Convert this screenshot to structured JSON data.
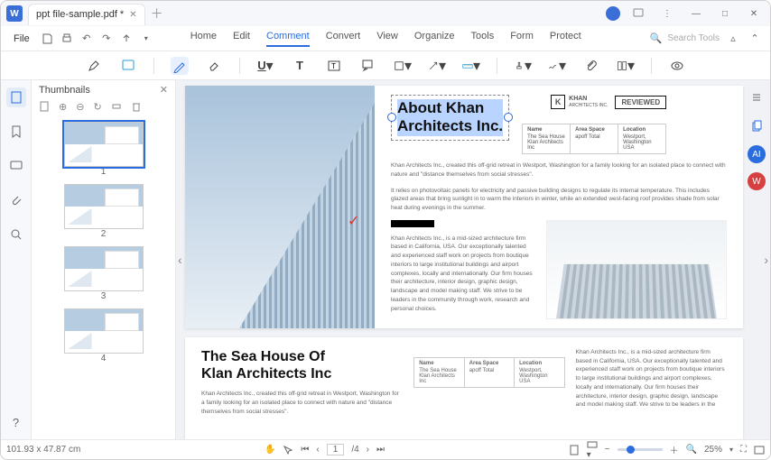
{
  "title": "ppt file-sample.pdf *",
  "fileMenu": "File",
  "menus": [
    "Home",
    "Edit",
    "Comment",
    "Convert",
    "View",
    "Organize",
    "Tools",
    "Form",
    "Protect"
  ],
  "activeMenu": "Comment",
  "searchPlaceholder": "Search Tools",
  "thumbnails": {
    "title": "Thumbnails",
    "labels": [
      "1",
      "2",
      "3",
      "4"
    ]
  },
  "page1": {
    "heading1": "About Khan",
    "heading2": "Architects Inc.",
    "logo": {
      "name": "KHAN",
      "sub": "ARCHITECTS INC."
    },
    "reviewed": "REVIEWED",
    "info": {
      "h1": "Name",
      "v1": "The Sea House Klan Architects Inc",
      "h2": "Area Space",
      "v2": "apoff Total",
      "h3": "Location",
      "v3": "Westport, Washington USA"
    },
    "p1": "Khan Architects Inc., created this off-grid retreat in Westport, Washington for a family looking for an isolated place to connect with nature and \"distance themselves from social stresses\".",
    "p2": "It relies on photovoltaic panels for electricity and passive building designs to regulate its internal temperature. This includes glazed areas that bring sunlight in to warm the interiors in winter, while an extended west-facing roof provides shade from solar heat during evenings in the summer.",
    "p3": "Khan Architects Inc., is a mid-sized architecture firm based in California, USA. Our exceptionally talented and experienced staff work on projects from boutique interiors to large institutional buildings and airport complexes, locally and internationally. Our firm houses their architecture, interior design, graphic design, landscape and model making staff. We strive to be leaders in the community through work, research and personal choices."
  },
  "page2": {
    "title1": "The Sea House Of",
    "title2": "Klan Architects Inc",
    "info": {
      "h1": "Name",
      "v1": "The Sea House Klan Architects Inc",
      "h2": "Area Space",
      "v2": "apoff Total",
      "h3": "Location",
      "v3": "Westport, Washington USA"
    },
    "p1": "Khan Architects Inc., created this off-grid retreat in Westport, Washington for a family looking for an isolated place to connect with nature and \"distance themselves from social stresses\".",
    "col": "Khan Architects Inc., is a mid-sized architecture firm based in California, USA. Our exceptionally talented and experienced staff work on projects from boutique interiors to large institutional buildings and airport complexes, locally and internationally. Our firm houses their architecture, interior design, graphic design, landscape and model making staff. We strive to be leaders in the"
  },
  "status": {
    "dim": "101.93 x 47.87 cm",
    "page": "1",
    "total": "/4",
    "zoom": "25%"
  }
}
